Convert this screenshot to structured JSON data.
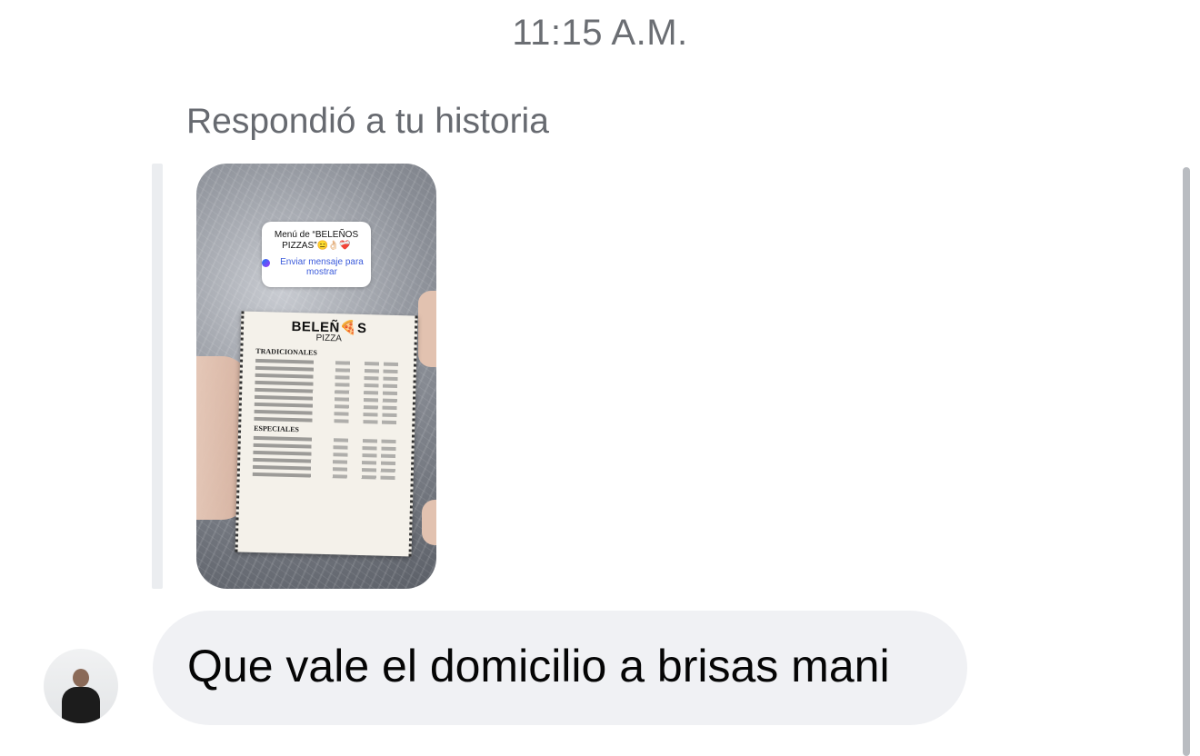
{
  "timestamp": "11:15 A.M.",
  "reply_label": "Respondió a tu historia",
  "story": {
    "sticker_title": "Menú de “BELEÑOS PIZZAS”😑👌🏻❤️‍🩹",
    "sticker_cta": "Enviar mensaje para mostrar",
    "menu": {
      "brand": "BELEÑ🍕S",
      "brand_sub": "PIZZA",
      "section_1": "TRADICIONALES",
      "section_2": "ESPECIALES"
    }
  },
  "message": {
    "text": "Que vale el domicilio a brisas mani"
  },
  "icons": {
    "avatar": "user-avatar",
    "messenger": "messenger-icon"
  },
  "colors": {
    "bubble_bg": "#f0f1f4",
    "timestamp": "#6b6e73",
    "cta": "#3b5bdb"
  }
}
